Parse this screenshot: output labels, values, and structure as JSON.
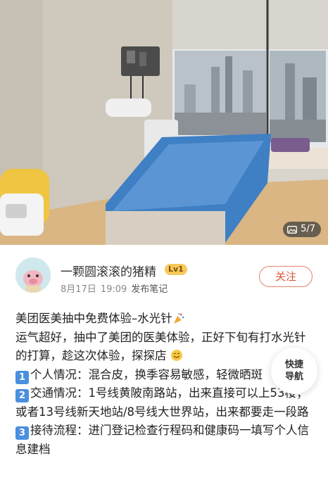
{
  "photo": {
    "counter": "5/7",
    "counter_icon": "image-icon"
  },
  "author": {
    "name": "一颗圆滚滚的猪精",
    "level": "Lv1",
    "date": "8月17日",
    "time": "19:09",
    "action": "发布笔记",
    "follow_label": "关注"
  },
  "post": {
    "title": "美团医美抽中免费体验–水光针",
    "line1": "运气超好，抽中了美团的医美体验，正好下旬有打水光针的打算，趁这次体验，探探店",
    "item1_num": "1",
    "item1": "个人情况：混合皮，换季容易敏感，轻微晒斑",
    "item2_num": "2",
    "item2": "交通情况：1号线黄陂南路站，出来直接可以上53楼；或者13号线新天地站/8号线大世界站，出来都要走一段路",
    "item3_num": "3",
    "item3": "接待流程：进门登记检查行程码和健康码一填写个人信息建档"
  },
  "quick_nav": {
    "line1": "快捷",
    "line2": "导航"
  },
  "colors": {
    "follow": "#d9573b",
    "level_badge": "#f7c85a",
    "number_badge": "#4a8fe0",
    "bed_cover": "#3f7fc4"
  }
}
